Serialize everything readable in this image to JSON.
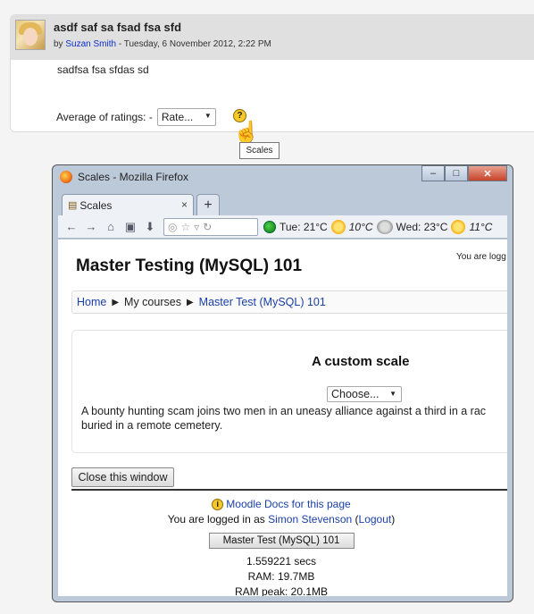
{
  "post": {
    "title": "asdf saf sa fsad fsa sfd",
    "by_prefix": "by",
    "author": "Suzan Smith",
    "date": "- Tuesday, 6 November 2012, 2:22 PM",
    "body": "sadfsa fsa sfdas sd",
    "rating_label": "Average of ratings: -",
    "rate_select": "Rate...",
    "help_icon": "question-icon",
    "tooltip": "Scales"
  },
  "window": {
    "title": "Scales - Mozilla Firefox",
    "buttons": {
      "minimize": "–",
      "maximize": "□",
      "close": "✕"
    },
    "tab": {
      "label": "Scales",
      "close": "×"
    },
    "newtab": "+",
    "nav": {
      "back": "←",
      "forward": "→",
      "home": "⌂",
      "bookmark": "▣",
      "download": "⬇",
      "star": "☆",
      "dropdown": "▿",
      "reload": "↻"
    },
    "forecast": {
      "day1": "Tue: 21°C",
      "day1_low": "10°C",
      "day2": "Wed: 23°C",
      "day2_low": "11°C"
    }
  },
  "page": {
    "logged_in_top": "You are logg",
    "course_title": "Master Testing (MySQL) 101",
    "breadcrumb": {
      "home": "Home",
      "my_courses": "My courses",
      "course": "Master Test (MySQL) 101",
      "separator": "▶"
    },
    "scale_title": "A custom scale",
    "choose": "Choose...",
    "scale_desc_line1": "A bounty hunting scam joins two men in an uneasy alliance against a third in a rac",
    "scale_desc_line2": "buried in a remote cemetery.",
    "close_button": "Close this window",
    "footer": {
      "docs_link": "Moodle Docs for this page",
      "logged_in_prefix": "You are logged in as",
      "user": "Simon Stevenson",
      "logout": "Logout",
      "course_button": "Master Test (MySQL) 101",
      "secs": "1.559221 secs",
      "ram": "RAM: 19.7MB",
      "ram_peak": "RAM peak: 20.1MB"
    }
  }
}
